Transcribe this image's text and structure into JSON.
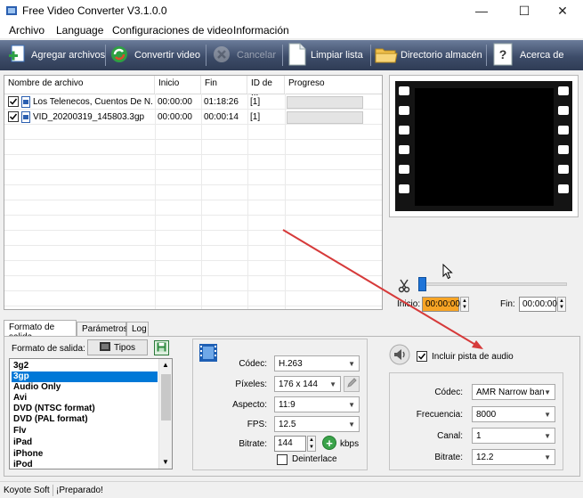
{
  "window": {
    "title": "Free Video Converter V3.1.0.0",
    "controls": {
      "minimize": "—",
      "maximize": "☐",
      "close": "✕"
    }
  },
  "menu": [
    "Archivo",
    "Language",
    "Configuraciones de video",
    "Información"
  ],
  "toolbar": {
    "add_files": "Agregar archivos",
    "convert": "Convertir video",
    "cancel": "Cancelar",
    "clear_list": "Limpiar lista",
    "output_dir": "Directorio almacén",
    "about": "Acerca de"
  },
  "file_table": {
    "columns": [
      "Nombre de archivo",
      "Inicio",
      "Fin",
      "ID de ...",
      "Progreso"
    ],
    "rows": [
      {
        "checked": true,
        "name": "Los Telenecos, Cuentos De N...",
        "start": "00:00:00",
        "end": "01:18:26",
        "id": "[1]"
      },
      {
        "checked": true,
        "name": "VID_20200319_145803.3gp",
        "start": "00:00:00",
        "end": "00:00:14",
        "id": "[1]"
      }
    ]
  },
  "trim": {
    "start_label": "Inicio:",
    "start_value": "00:00:00",
    "end_label": "Fin:",
    "end_value": "00:00:00",
    "slider_position": 0
  },
  "tabs": [
    "Formato de salida",
    "Parámetros",
    "Log"
  ],
  "output": {
    "format_label": "Formato de salida:",
    "types_button": "Tipos",
    "formats": [
      "3g2",
      "3gp",
      "Audio Only",
      "Avi",
      "DVD (NTSC format)",
      "DVD (PAL format)",
      "Flv",
      "iPad",
      "iPhone",
      "iPod"
    ],
    "selected_format": "3gp"
  },
  "video": {
    "codec_label": "Códec:",
    "codec": "H.263",
    "pixels_label": "Píxeles:",
    "pixels": "176 x 144",
    "aspect_label": "Aspecto:",
    "aspect": "11:9",
    "fps_label": "FPS:",
    "fps": "12.5",
    "bitrate_label": "Bitrate:",
    "bitrate": "144",
    "bitrate_unit": "kbps",
    "deinterlace_label": "Deinterlace",
    "deinterlace": false
  },
  "audio": {
    "include_label": "Incluir pista de audio",
    "include": true,
    "codec_label": "Códec:",
    "codec": "AMR Narrow ban",
    "freq_label": "Frecuencia:",
    "freq": "8000",
    "channel_label": "Canal:",
    "channel": "1",
    "bitrate_label": "Bitrate:",
    "bitrate": "12.2"
  },
  "status": {
    "company": "Koyote Soft",
    "message": "¡Preparado!"
  },
  "colors": {
    "toolbar": "#3d4c69",
    "selection": "#0078d7",
    "time_highlight": "#f7a425",
    "annotation_arrow": "#d63a3a"
  }
}
